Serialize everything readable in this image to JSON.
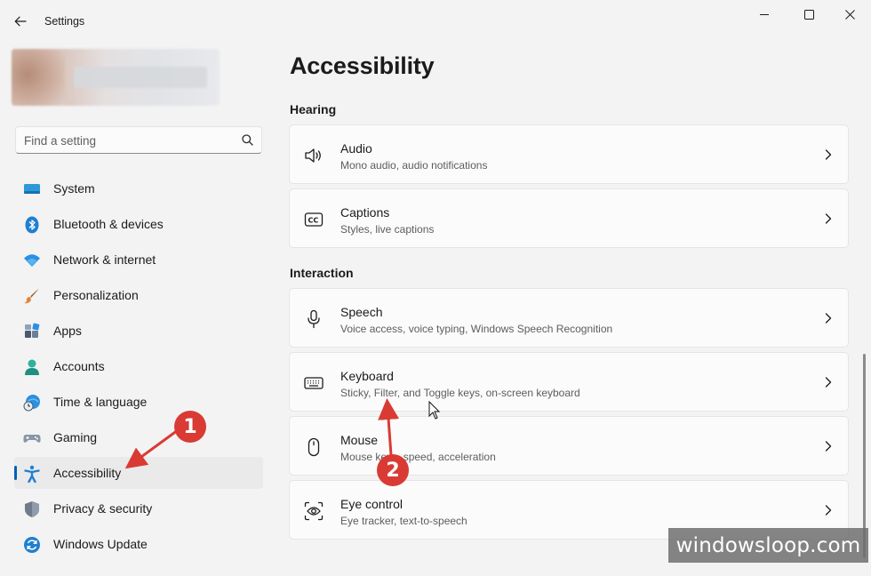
{
  "window": {
    "title": "Settings"
  },
  "search": {
    "placeholder": "Find a setting"
  },
  "nav": {
    "items": [
      {
        "label": "System",
        "icon": "system-icon"
      },
      {
        "label": "Bluetooth & devices",
        "icon": "bluetooth-icon"
      },
      {
        "label": "Network & internet",
        "icon": "wifi-icon"
      },
      {
        "label": "Personalization",
        "icon": "brush-icon"
      },
      {
        "label": "Apps",
        "icon": "apps-icon"
      },
      {
        "label": "Accounts",
        "icon": "accounts-icon"
      },
      {
        "label": "Time & language",
        "icon": "clock-globe-icon"
      },
      {
        "label": "Gaming",
        "icon": "gamepad-icon"
      },
      {
        "label": "Accessibility",
        "icon": "accessibility-icon",
        "selected": true
      },
      {
        "label": "Privacy & security",
        "icon": "shield-icon"
      },
      {
        "label": "Windows Update",
        "icon": "update-icon"
      }
    ]
  },
  "page": {
    "title": "Accessibility"
  },
  "sections": [
    {
      "title": "Hearing",
      "cards": [
        {
          "title": "Audio",
          "subtitle": "Mono audio, audio notifications",
          "icon": "speaker-icon"
        },
        {
          "title": "Captions",
          "subtitle": "Styles, live captions",
          "icon": "captions-icon"
        }
      ]
    },
    {
      "title": "Interaction",
      "cards": [
        {
          "title": "Speech",
          "subtitle": "Voice access, voice typing, Windows Speech Recognition",
          "icon": "microphone-icon"
        },
        {
          "title": "Keyboard",
          "subtitle": "Sticky, Filter, and Toggle keys, on-screen keyboard",
          "icon": "keyboard-icon"
        },
        {
          "title": "Mouse",
          "subtitle": "Mouse keys, speed, acceleration",
          "icon": "mouse-icon"
        },
        {
          "title": "Eye control",
          "subtitle": "Eye tracker, text-to-speech",
          "icon": "eye-control-icon"
        }
      ]
    }
  ],
  "annotations": {
    "step1": "1",
    "step2": "2",
    "watermark": "windowsloop.com"
  },
  "colors": {
    "accent": "#005fb8",
    "annotation": "#d93a34",
    "background": "#f3f3f3",
    "card": "#fbfbfb"
  }
}
